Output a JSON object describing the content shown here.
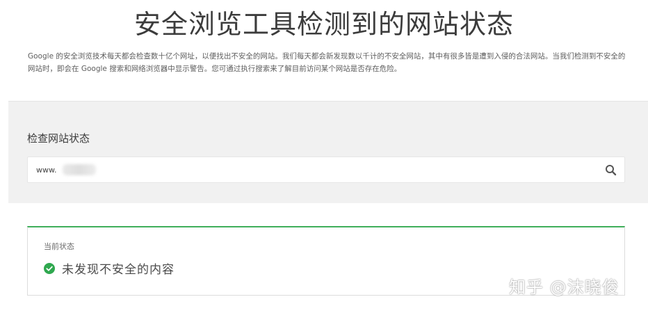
{
  "header": {
    "title": "安全浏览工具检测到的网站状态",
    "intro": "Google 的安全浏览技术每天都会检查数十亿个网址，以便找出不安全的网站。我们每天都会新发现数以千计的不安全网站，其中有很多皆是遭到入侵的合法网站。当我们检测到不安全的网站时，即会在 Google 搜索和网络浏览器中显示警告。您可通过执行搜索来了解目前访问某个网站是否存在危险。"
  },
  "check": {
    "title": "检查网站状态",
    "url_value": "www.",
    "search_icon": "search-icon"
  },
  "status": {
    "label": "当前状态",
    "text": "未发现不安全的内容",
    "icon": "check-circle-icon",
    "accent_color": "#3fae5a"
  },
  "watermark": {
    "text": "知乎 @沫晓俊"
  }
}
